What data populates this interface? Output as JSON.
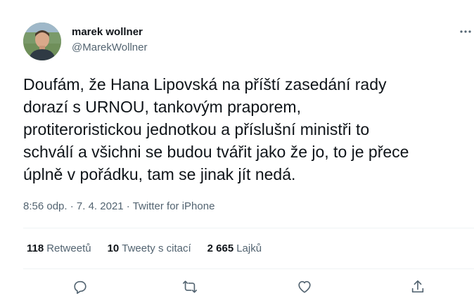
{
  "author": {
    "display_name": "marek wollner",
    "handle": "@MarekWollner",
    "avatar_icon": "person-avatar"
  },
  "more_icon": "more-dots-icon",
  "tweet": {
    "lines": [
      "Doufám, že Hana Lipovská na příští zasedání rady",
      "dorazí s URNOU, tankovým praporem,",
      "protiteroristickou jednotkou a příslušní ministři to",
      "schválí a všichni se budou tvářit jako že jo, to je přece",
      "úplně v pořádku, tam se jinak jít nedá."
    ]
  },
  "meta": {
    "time": "8:56 odp.",
    "separator": " · ",
    "date": "7. 4. 2021",
    "source": "Twitter for iPhone"
  },
  "stats": {
    "retweets_count": "118",
    "retweets_label": "Retweetů",
    "quotes_count": "10",
    "quotes_label": "Tweety s citací",
    "likes_count": "2 665",
    "likes_label": "Lajků"
  },
  "actions": [
    "reply-icon",
    "retweet-icon",
    "like-icon",
    "share-icon"
  ],
  "colors": {
    "text": "#0f1419",
    "secondary": "#536471",
    "divider": "#eff3f4"
  }
}
